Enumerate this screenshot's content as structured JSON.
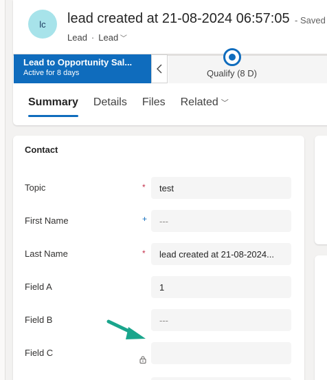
{
  "header": {
    "avatar_initials": "lc",
    "title": "lead created at 21-08-2024 06:57:05",
    "saved_status": "- Saved",
    "entity": "Lead",
    "form_selector": "Lead"
  },
  "process": {
    "name": "Lead to Opportunity Sal...",
    "status": "Active for 8 days",
    "stage_label": "Qualify",
    "stage_duration": "(8 D)"
  },
  "tabs": [
    {
      "label": "Summary",
      "active": true
    },
    {
      "label": "Details"
    },
    {
      "label": "Files"
    },
    {
      "label": "Related"
    }
  ],
  "contact": {
    "section_title": "Contact",
    "fields": [
      {
        "label": "Topic",
        "value": "test",
        "indicator": "required"
      },
      {
        "label": "First Name",
        "value": "---",
        "indicator": "recommended"
      },
      {
        "label": "Last Name",
        "value": "lead created at 21-08-2024...",
        "indicator": "required"
      },
      {
        "label": "Field A",
        "value": "1",
        "indicator": "none"
      },
      {
        "label": "Field B",
        "value": "---",
        "indicator": "none"
      },
      {
        "label": "Field C",
        "value": "",
        "indicator": "locked"
      }
    ],
    "required_mark": "*",
    "recommended_mark": "+"
  },
  "colors": {
    "accent": "#0f6cbd",
    "required": "#c4314b",
    "annotation_arrow": "#1aa58c",
    "avatar_bg": "#a7e3ea"
  },
  "icons": {
    "form_chevron": "chevron-down-icon",
    "collapse": "chevron-left-icon",
    "lock": "lock-icon",
    "arrow": "arrow-icon"
  }
}
